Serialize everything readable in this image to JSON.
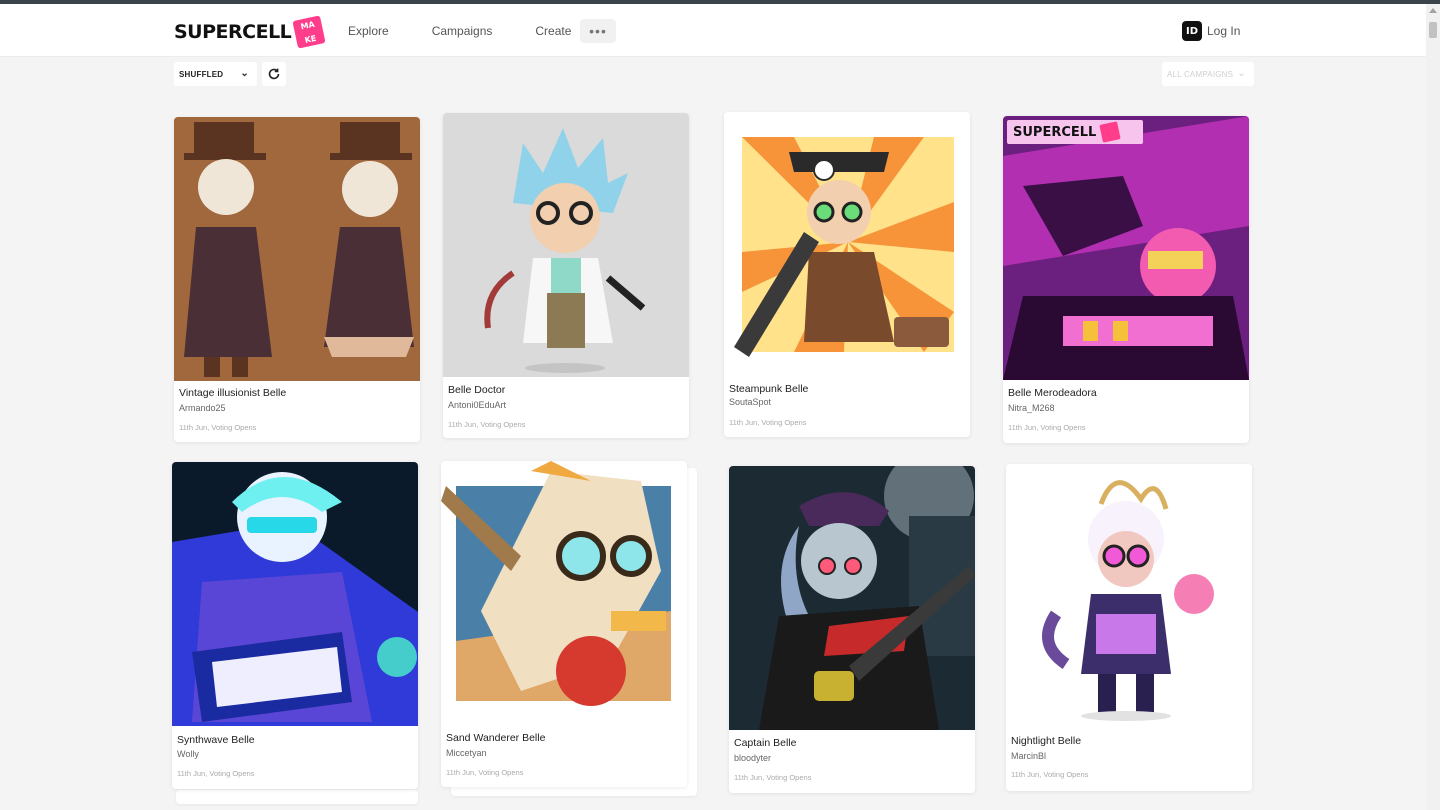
{
  "brand": {
    "name": "SUPERCELL",
    "make_top": "MA",
    "make_bottom": "KE"
  },
  "nav": {
    "items": [
      "Explore",
      "Campaigns",
      "Create"
    ],
    "more": "•••"
  },
  "login": {
    "badge": "ID",
    "label": "Log In"
  },
  "filters": {
    "sort_value": "SHUFFLED",
    "campaign_value": "ALL CAMPAIGNS"
  },
  "cards": [
    {
      "title": "Vintage illusionist Belle",
      "author": "Armando25",
      "meta": "11th Jun, Voting Opens"
    },
    {
      "title": "Belle Doctor",
      "author": "Antoni0EduArt",
      "meta": "11th Jun, Voting Opens"
    },
    {
      "title": "Steampunk Belle",
      "author": "SoutaSpot",
      "meta": "11th Jun, Voting Opens"
    },
    {
      "title": "Belle Merodeadora",
      "author": "Nitra_M268",
      "meta": "11th Jun, Voting Opens",
      "overlay_brand": "SUPERCELL"
    },
    {
      "title": "Synthwave Belle",
      "author": "Wolly",
      "meta": "11th Jun, Voting Opens"
    },
    {
      "title": "Sand Wanderer Belle",
      "author": "Miccetyan",
      "meta": "11th Jun, Voting Opens"
    },
    {
      "title": "Captain Belle",
      "author": "bloodyter",
      "meta": "11th Jun, Voting Opens"
    },
    {
      "title": "Nightlight Belle",
      "author": "MarcinBl",
      "meta": "11th Jun, Voting Opens"
    }
  ],
  "colors": {
    "accent": "#ff3d8b",
    "background": "#f4f4f4",
    "card": "#ffffff"
  }
}
